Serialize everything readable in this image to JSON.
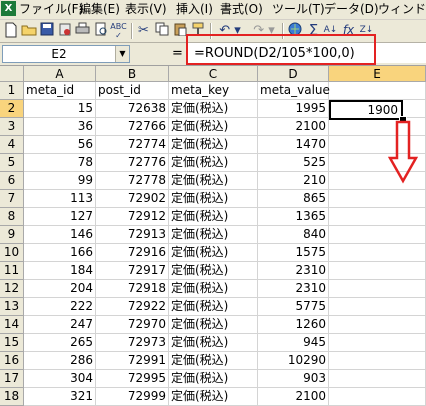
{
  "menu": {
    "items": [
      "ファイル(F)",
      "編集(E)",
      "表示(V)",
      "挿入(I)",
      "書式(O)",
      "ツール(T)",
      "データ(D)",
      "ウィンドウ(W)"
    ]
  },
  "toolbar": {
    "icons": [
      "new-document-icon",
      "open-folder-icon",
      "save-icon",
      "permission-icon",
      "print-icon",
      "print-preview-icon",
      "spelling-icon",
      "cut-icon",
      "copy-icon",
      "paste-icon",
      "format-painter-icon",
      "undo-icon",
      "redo-icon",
      "hyperlink-icon",
      "autosum-icon",
      "sort-ascending-icon",
      "insert-function-icon",
      "sort-descending-icon"
    ],
    "glyphs": {
      "autosum": "Σ",
      "fx": "fx"
    }
  },
  "formula_bar": {
    "name_box": "E2",
    "equals": "=",
    "formula": "=ROUND(D2/105*100,0)"
  },
  "sheet": {
    "columns": [
      "A",
      "B",
      "C",
      "D",
      "E"
    ],
    "active_column": "E",
    "active_row": 2,
    "selected_cell": {
      "address": "E2",
      "value": "1900"
    },
    "rows": [
      {
        "n": "1",
        "a": "meta_id",
        "b": "post_id",
        "c": "meta_key",
        "d": "meta_value"
      },
      {
        "n": "2",
        "a": "15",
        "b": "72638",
        "c": "定価(税込)",
        "d": "1995"
      },
      {
        "n": "3",
        "a": "36",
        "b": "72766",
        "c": "定価(税込)",
        "d": "2100"
      },
      {
        "n": "4",
        "a": "56",
        "b": "72774",
        "c": "定価(税込)",
        "d": "1470"
      },
      {
        "n": "5",
        "a": "78",
        "b": "72776",
        "c": "定価(税込)",
        "d": "525"
      },
      {
        "n": "6",
        "a": "99",
        "b": "72778",
        "c": "定価(税込)",
        "d": "210"
      },
      {
        "n": "7",
        "a": "113",
        "b": "72902",
        "c": "定価(税込)",
        "d": "865"
      },
      {
        "n": "8",
        "a": "127",
        "b": "72912",
        "c": "定価(税込)",
        "d": "1365"
      },
      {
        "n": "9",
        "a": "146",
        "b": "72913",
        "c": "定価(税込)",
        "d": "840"
      },
      {
        "n": "10",
        "a": "166",
        "b": "72916",
        "c": "定価(税込)",
        "d": "1575"
      },
      {
        "n": "11",
        "a": "184",
        "b": "72917",
        "c": "定価(税込)",
        "d": "2310"
      },
      {
        "n": "12",
        "a": "204",
        "b": "72918",
        "c": "定価(税込)",
        "d": "2310"
      },
      {
        "n": "13",
        "a": "222",
        "b": "72922",
        "c": "定価(税込)",
        "d": "5775"
      },
      {
        "n": "14",
        "a": "247",
        "b": "72970",
        "c": "定価(税込)",
        "d": "1260"
      },
      {
        "n": "15",
        "a": "265",
        "b": "72973",
        "c": "定価(税込)",
        "d": "945"
      },
      {
        "n": "16",
        "a": "286",
        "b": "72991",
        "c": "定価(税込)",
        "d": "10290"
      },
      {
        "n": "17",
        "a": "304",
        "b": "72995",
        "c": "定価(税込)",
        "d": "903"
      },
      {
        "n": "18",
        "a": "321",
        "b": "72999",
        "c": "定価(税込)",
        "d": "2100"
      }
    ]
  },
  "colors": {
    "formula_highlight": "#e32222",
    "fill_arrow": "#e32222",
    "active_header": "#f9d47d",
    "chrome": "#ece9d8"
  }
}
